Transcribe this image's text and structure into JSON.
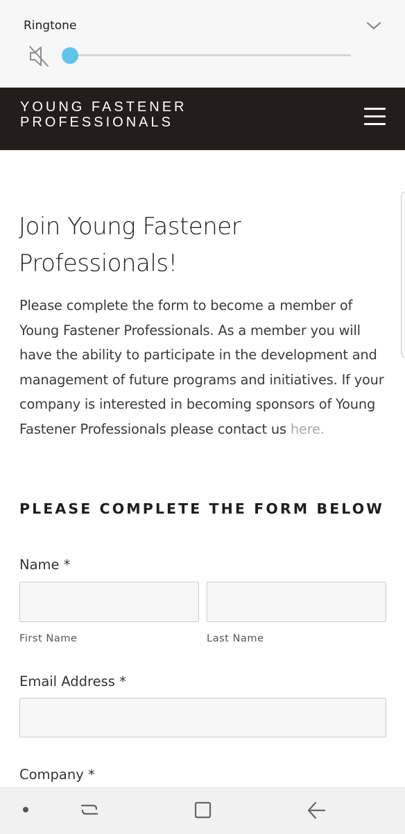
{
  "volume_panel": {
    "label": "Ringtone",
    "level": 0,
    "muted": true,
    "accent_color": "#5ec4ec",
    "icons": [
      "mute-icon",
      "chevron-down-icon"
    ]
  },
  "header": {
    "logo_line1": "YOUNG FASTENER",
    "logo_line2": "PROFESSIONALS",
    "background_color": "#221e1b",
    "menu_icon": "hamburger-menu-icon"
  },
  "content": {
    "title_line1": "Join Young Fastener",
    "title_line2": "Professionals!",
    "intro_text": "Please complete the form to become a member of Young Fastener Professionals. As a member you will have the ability to participate in the development and management of future programs and initiatives. If your company is interested in becoming sponsors of Young Fastener Professionals please contact us ",
    "intro_link": "here.",
    "form_heading": "PLEASE COMPLETE THE FORM BELOW"
  },
  "form": {
    "name_label": "Name *",
    "first_name_label": "First Name",
    "last_name_label": "Last Name",
    "first_name_value": "",
    "last_name_value": "",
    "email_label": "Email Address *",
    "email_value": "",
    "company_label": "Company *"
  },
  "nav_bar": {
    "icons": [
      "dot-icon",
      "recent-apps-icon",
      "home-icon",
      "back-icon"
    ]
  }
}
